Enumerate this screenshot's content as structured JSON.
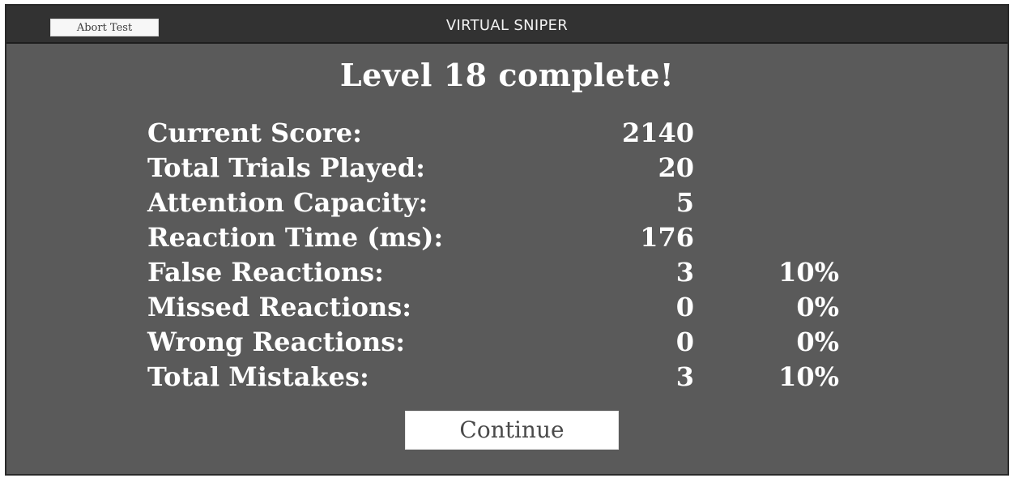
{
  "window": {
    "title": "VIRTUAL SNIPER",
    "abort_label": "Abort Test"
  },
  "results": {
    "heading": "Level 18 complete!",
    "rows": [
      {
        "label": "Current Score:",
        "value": "2140",
        "percent": ""
      },
      {
        "label": "Total Trials Played:",
        "value": "20",
        "percent": ""
      },
      {
        "label": "Attention Capacity:",
        "value": "5",
        "percent": ""
      },
      {
        "label": "Reaction Time (ms):",
        "value": "176",
        "percent": ""
      },
      {
        "label": "False Reactions:",
        "value": "3",
        "percent": "10%"
      },
      {
        "label": "Missed Reactions:",
        "value": "0",
        "percent": "0%"
      },
      {
        "label": "Wrong Reactions:",
        "value": "0",
        "percent": "0%"
      },
      {
        "label": "Total Mistakes:",
        "value": "3",
        "percent": "10%"
      }
    ]
  },
  "actions": {
    "continue_label": "Continue"
  },
  "colors": {
    "titlebar": "#323232",
    "panel": "#5a5a5a",
    "text": "#ffffff",
    "button": "#ffffff"
  }
}
